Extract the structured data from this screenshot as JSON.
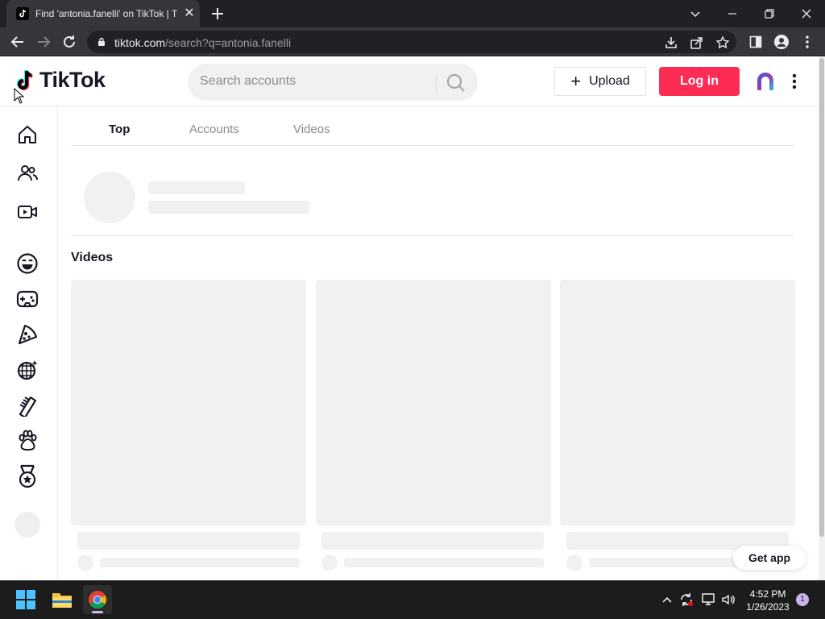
{
  "browser": {
    "tab_title": "Find 'antonia.fanelli' on TikTok | T",
    "url_host": "tiktok.com",
    "url_path": "/search?q=antonia.fanelli"
  },
  "header": {
    "logo_text": "TikTok",
    "search_placeholder": "Search accounts",
    "upload_label": "Upload",
    "login_label": "Log in",
    "brand_color": "#fe2c55"
  },
  "tabs": [
    {
      "label": "Top",
      "active": true
    },
    {
      "label": "Accounts",
      "active": false
    },
    {
      "label": "Videos",
      "active": false
    }
  ],
  "sidebar_icons": [
    "home-icon",
    "following-icon",
    "live-icon",
    "comedy-icon",
    "gaming-icon",
    "food-icon",
    "dance-icon",
    "beauty-icon",
    "animals-icon",
    "sports-icon"
  ],
  "videos_heading": "Videos",
  "get_app_label": "Get app",
  "taskbar": {
    "time": "4:52 PM",
    "date": "1/26/2023",
    "notification_count": "1"
  }
}
